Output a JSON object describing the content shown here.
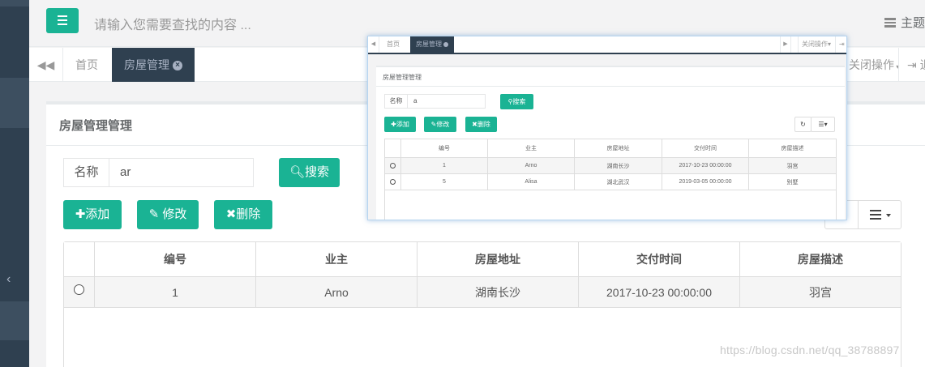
{
  "header": {
    "search_placeholder": "请输入您需要查找的内容 ...",
    "theme_label": "主题"
  },
  "tabs": {
    "home": "首页",
    "active": "房屋管理",
    "close_ops": "关闭操作",
    "exit": "退"
  },
  "panel": {
    "title": "房屋管理管理",
    "search": {
      "label": "名称",
      "value": "ar",
      "button": "搜索"
    },
    "actions": {
      "add": "添加",
      "edit": "修改",
      "delete": "删除"
    },
    "table": {
      "columns": [
        "编号",
        "业主",
        "房屋地址",
        "交付时间",
        "房屋描述"
      ],
      "rows": [
        [
          "1",
          "Arno",
          "湖南长沙",
          "2017-10-23 00:00:00",
          "羽宫"
        ]
      ]
    }
  },
  "popup": {
    "tabs": {
      "home": "首页",
      "active": "房屋管理",
      "close_ops": "关闭操作"
    },
    "title": "房屋管理管理",
    "search": {
      "label": "名称",
      "value": "a",
      "button": "搜索"
    },
    "actions": {
      "add": "添加",
      "edit": "修改",
      "delete": "删除"
    },
    "table": {
      "columns": [
        "编号",
        "业主",
        "房屋地址",
        "交付时间",
        "房屋描述"
      ],
      "rows": [
        [
          "1",
          "Arno",
          "湖南长沙",
          "2017-10-23 00:00:00",
          "羽宫"
        ],
        [
          "5",
          "Alisa",
          "湖北武汉",
          "2019-03-05 00:00:00",
          "别墅"
        ]
      ]
    }
  },
  "watermark": "https://blog.csdn.net/qq_38788897",
  "colors": {
    "primary": "#1ab394",
    "sidebar": "#2f4050"
  }
}
